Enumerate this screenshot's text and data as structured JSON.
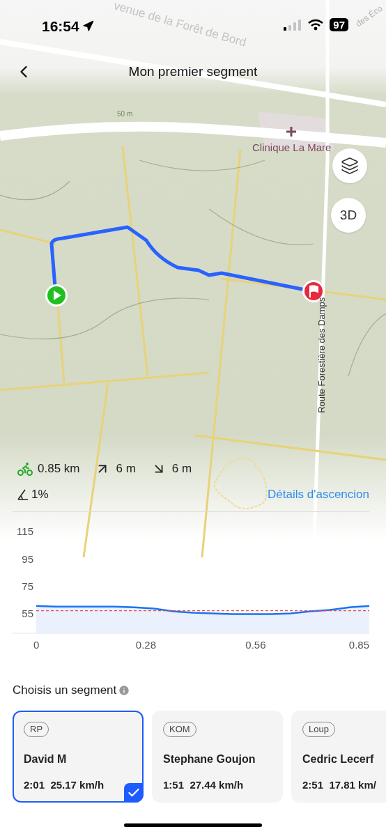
{
  "status_bar": {
    "time": "16:54",
    "battery": "97"
  },
  "header": {
    "title": "Mon premier segment"
  },
  "map": {
    "street_top": "venue de la Forêt de Bord",
    "street_corner": "des Éco",
    "contour_label": "50 m",
    "poi": "Clinique La Mare",
    "street_vertical": "Route Forestière des Damps",
    "view_button": "3D"
  },
  "stats": {
    "distance": "0.85 km",
    "ascent": "6 m",
    "descent": "6 m",
    "grade": "1%",
    "details_link": "Détails d'ascencion"
  },
  "elevation": {
    "chart_data": {
      "type": "area",
      "x": [
        0,
        0.05,
        0.1,
        0.15,
        0.2,
        0.25,
        0.3,
        0.35,
        0.4,
        0.45,
        0.5,
        0.55,
        0.6,
        0.65,
        0.7,
        0.75,
        0.8,
        0.85
      ],
      "series": [
        {
          "color": "#1a73f0",
          "values": [
            61,
            60.5,
            60.5,
            60.5,
            60.5,
            60,
            59,
            57,
            56,
            55.5,
            55,
            55,
            55,
            55.5,
            57,
            58,
            60,
            61
          ]
        }
      ],
      "xlim": [
        0,
        0.85
      ],
      "ylim": [
        41,
        130
      ],
      "xticks": [
        0,
        0.28,
        0.56,
        0.85
      ],
      "yticks": [
        55,
        75,
        95,
        115
      ],
      "ref_lines": [
        {
          "axis": "y",
          "value": 57.5,
          "color": "#e84a4a"
        }
      ]
    }
  },
  "segments": {
    "title": "Choisis un segment",
    "items": [
      {
        "badge": "RP",
        "name": "David M",
        "time": "2:01",
        "speed": "25.17 km/h",
        "selected": true
      },
      {
        "badge": "KOM",
        "name": "Stephane Goujon",
        "time": "1:51",
        "speed": "27.44 km/h",
        "selected": false
      },
      {
        "badge": "Loup",
        "name": "Cedric Lecerf",
        "time": "2:51",
        "speed": "17.81 km/",
        "selected": false
      }
    ]
  }
}
